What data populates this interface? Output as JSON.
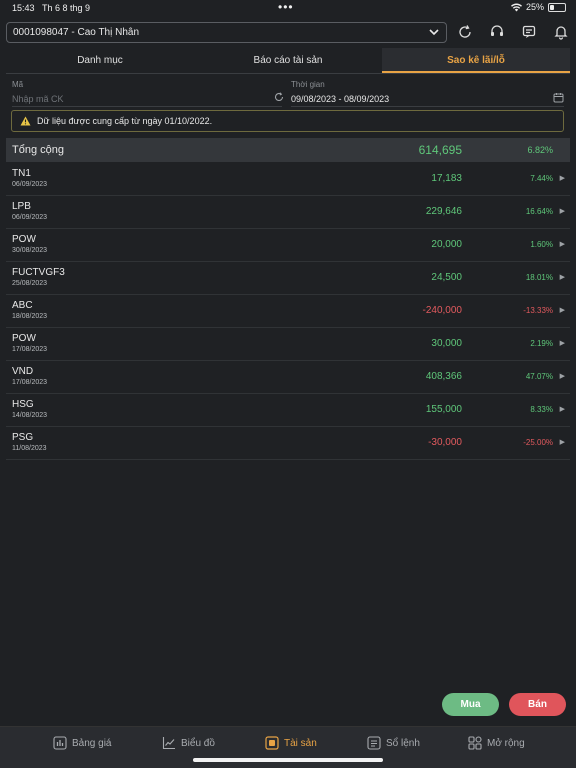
{
  "status_bar": {
    "time": "15:43",
    "date": "Th 6 8 thg 9",
    "battery": "25%",
    "battery_level": 0.25
  },
  "account": {
    "value": "0001098047 - Cao Thị Nhân"
  },
  "top_icons": [
    "refresh-icon",
    "headset-icon",
    "message-icon",
    "bell-icon"
  ],
  "tabs": [
    {
      "label": "Danh mục",
      "active": false
    },
    {
      "label": "Báo cáo tài sản",
      "active": false
    },
    {
      "label": "Sao kê lãi/lỗ",
      "active": true
    }
  ],
  "filters": {
    "code_label": "Mã",
    "code_placeholder": "Nhập mã CK",
    "time_label": "Thời gian",
    "time_value": "09/08/2023 - 08/09/2023"
  },
  "notice": "Dữ liệu được cung cấp từ ngày 01/10/2022.",
  "total": {
    "label": "Tổng cộng",
    "value": "614,695",
    "pct": "6.82%"
  },
  "rows": [
    {
      "symbol": "TN1",
      "date": "06/09/2023",
      "value": "17,183",
      "pct": "7.44%",
      "positive": true
    },
    {
      "symbol": "LPB",
      "date": "06/09/2023",
      "value": "229,646",
      "pct": "16.64%",
      "positive": true
    },
    {
      "symbol": "POW",
      "date": "30/08/2023",
      "value": "20,000",
      "pct": "1.60%",
      "positive": true
    },
    {
      "symbol": "FUCTVGF3",
      "date": "25/08/2023",
      "value": "24,500",
      "pct": "18.01%",
      "positive": true
    },
    {
      "symbol": "ABC",
      "date": "18/08/2023",
      "value": "-240,000",
      "pct": "-13.33%",
      "positive": false
    },
    {
      "symbol": "POW",
      "date": "17/08/2023",
      "value": "30,000",
      "pct": "2.19%",
      "positive": true
    },
    {
      "symbol": "VND",
      "date": "17/08/2023",
      "value": "408,366",
      "pct": "47.07%",
      "positive": true
    },
    {
      "symbol": "HSG",
      "date": "14/08/2023",
      "value": "155,000",
      "pct": "8.33%",
      "positive": true
    },
    {
      "symbol": "PSG",
      "date": "11/08/2023",
      "value": "-30,000",
      "pct": "-25.00%",
      "positive": false
    }
  ],
  "actions": {
    "buy": "Mua",
    "sell": "Bán"
  },
  "bottom_nav": [
    {
      "label": "Bảng giá",
      "icon": "price-board-icon",
      "active": false
    },
    {
      "label": "Biểu đồ",
      "icon": "chart-icon",
      "active": false
    },
    {
      "label": "Tài sản",
      "icon": "assets-icon",
      "active": true
    },
    {
      "label": "Sổ lệnh",
      "icon": "order-book-icon",
      "active": false
    },
    {
      "label": "Mở rộng",
      "icon": "grid-icon",
      "active": false
    }
  ],
  "colors": {
    "accent": "#e8a345",
    "positive": "#5fc77a",
    "negative": "#e25a5e",
    "buy": "#6dbb84",
    "sell": "#e0555b"
  }
}
